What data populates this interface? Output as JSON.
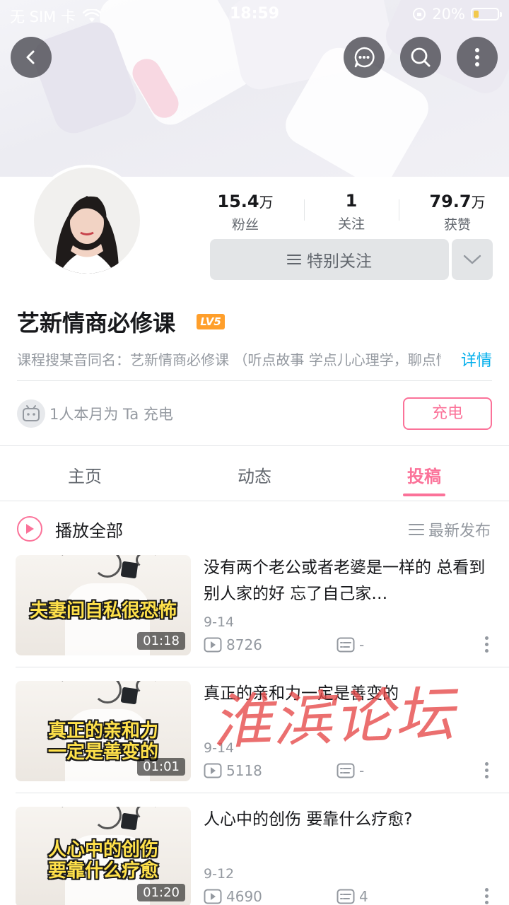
{
  "status_bar": {
    "carrier": "无 SIM 卡",
    "time": "18:59",
    "battery": "20%"
  },
  "profile": {
    "stats": [
      {
        "value": "15.4",
        "unit": "万",
        "label": "粉丝"
      },
      {
        "value": "1",
        "unit": "",
        "label": "关注"
      },
      {
        "value": "79.7",
        "unit": "万",
        "label": "获赞"
      }
    ],
    "follow_label": "特别关注",
    "name": "艺新情商必修课",
    "level": "LV5",
    "intro": "课程搜某音同名：艺新情商必修课 （听点故事 学点儿心理学，聊点情商的事儿）",
    "detail_label": "详情",
    "charge_text": "1人本月为 Ta 充电",
    "charge_button": "充电"
  },
  "tabs": [
    {
      "label": "主页",
      "active": false
    },
    {
      "label": "动态",
      "active": false
    },
    {
      "label": "投稿",
      "active": true
    }
  ],
  "list_header": {
    "play_all": "播放全部",
    "sort": "最新发布"
  },
  "videos": [
    {
      "caption": "夫妻间自私很恐怖",
      "duration": "01:18",
      "title": "没有两个老公或者老婆是一样的 总看到别人家的好 忘了自己家…",
      "date": "9-14",
      "plays": "8726",
      "danmaku": "-"
    },
    {
      "caption_line1": "真正的亲和力",
      "caption_line2": "一定是善变的",
      "duration": "01:01",
      "title": "真正的亲和力一定是善变的",
      "date": "9-14",
      "plays": "5118",
      "danmaku": "-"
    },
    {
      "caption_line1": "人心中的创伤",
      "caption_line2": "要靠什么疗愈",
      "duration": "01:20",
      "title": "人心中的创伤 要靠什么疗愈?",
      "date": "9-12",
      "plays": "4690",
      "danmaku": "4"
    }
  ],
  "watermark": "淮滨论坛",
  "colors": {
    "accent": "#fb7299",
    "link": "#00aeec",
    "level": "#ff9f2b"
  }
}
